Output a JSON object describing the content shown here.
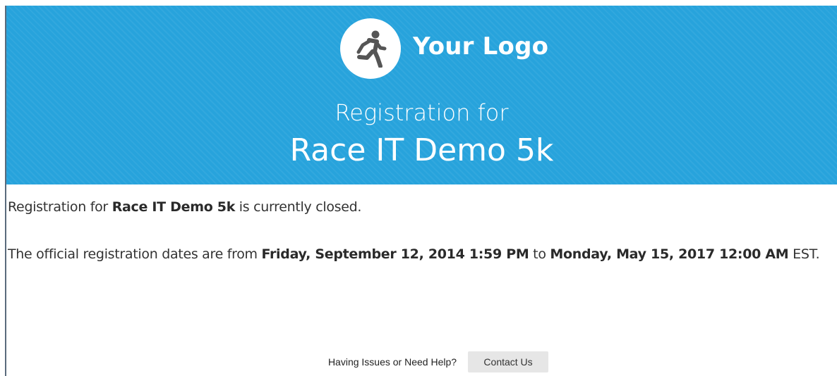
{
  "header": {
    "logo_text": "Your Logo",
    "logo_icon": "running-person-icon",
    "registration_for": "Registration for",
    "event_title": "Race IT Demo 5k",
    "bg_color": "#27a3dc"
  },
  "body": {
    "line1": {
      "prefix": "Registration for ",
      "event": "Race IT Demo 5k",
      "suffix": " is currently closed."
    },
    "line2": {
      "prefix": "The official registration dates are from ",
      "start": "Friday, September 12, 2014 1:59 PM",
      "middle": " to ",
      "end": "Monday, May 15, 2017 12:00 AM",
      "suffix": " EST."
    }
  },
  "footer": {
    "help_text": "Having Issues or Need Help?",
    "contact_label": "Contact Us"
  }
}
